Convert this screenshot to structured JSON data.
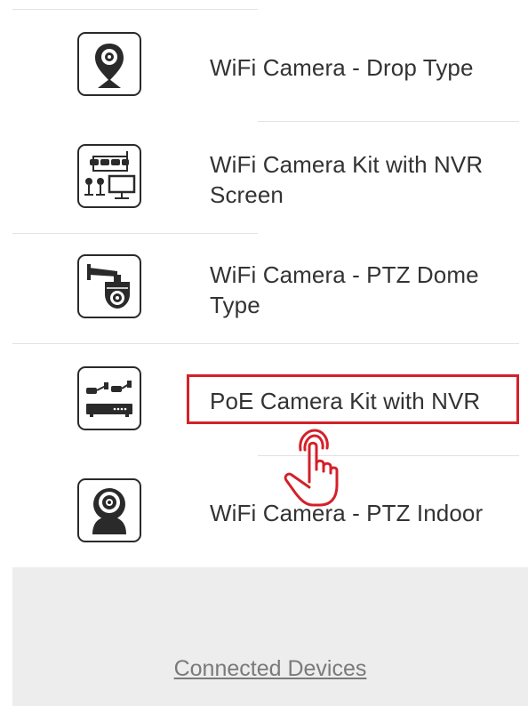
{
  "device_list": {
    "items": [
      {
        "label_line1": "WiFi Camera - Drop Type",
        "label_line2": "",
        "icon": "drop-camera-icon"
      },
      {
        "label_line1": "WiFi Camera Kit with NVR",
        "label_line2": "Screen",
        "icon": "camera-kit-nvr-screen-icon"
      },
      {
        "label_line1": "WiFi Camera - PTZ Dome",
        "label_line2": "Type",
        "icon": "ptz-dome-camera-icon"
      },
      {
        "label_line1": "PoE Camera Kit with NVR",
        "label_line2": "",
        "icon": "poe-camera-kit-icon"
      },
      {
        "label_line1": "WiFi Camera - PTZ Indoor",
        "label_line2": "",
        "icon": "ptz-indoor-camera-icon"
      }
    ]
  },
  "footer": {
    "link_label": "Connected Devices"
  },
  "colors": {
    "highlight": "#d4202a",
    "hand": "#d4202a",
    "text": "#333333",
    "footer_bg": "#ededed"
  }
}
